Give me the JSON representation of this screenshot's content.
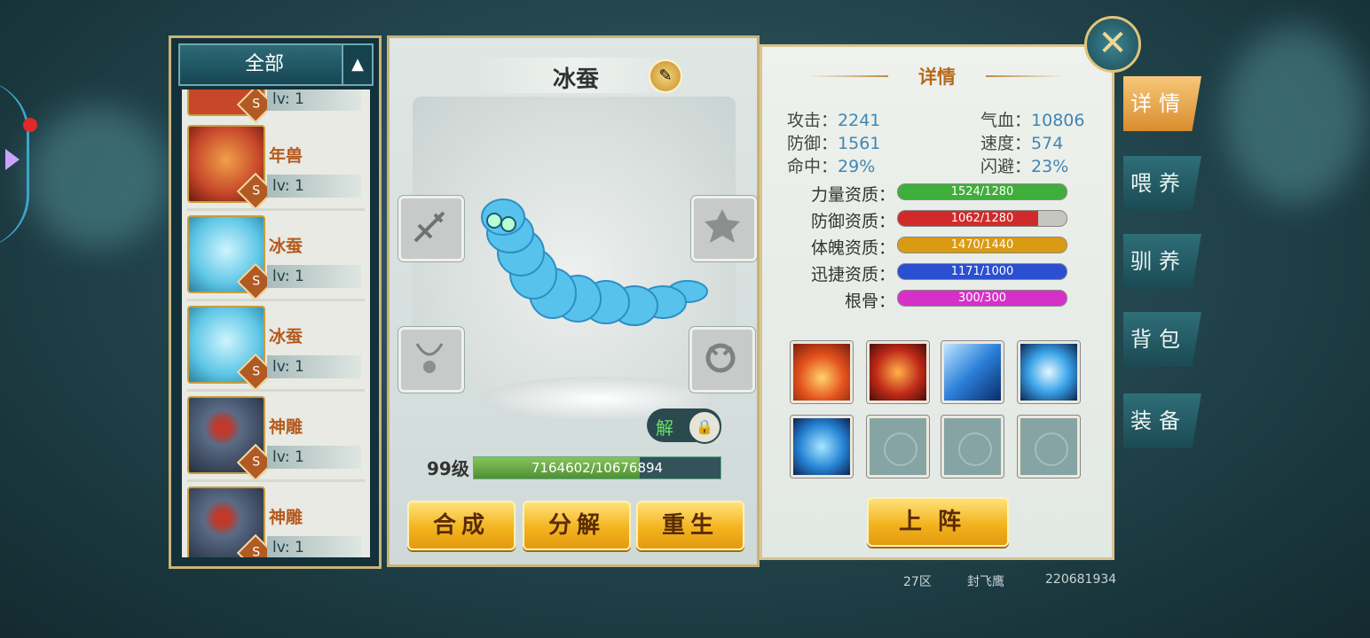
{
  "list": {
    "header": "全部",
    "toggle_icon": "chevron-up-icon",
    "partial_top_lv": "lv: 1",
    "items": [
      {
        "name": "年兽",
        "level": "lv: 1",
        "rank": "S",
        "color": "#c7472a"
      },
      {
        "name": "冰蚕",
        "level": "lv: 1",
        "rank": "S",
        "color": "#5fc7e6"
      },
      {
        "name": "冰蚕",
        "level": "lv: 1",
        "rank": "S",
        "color": "#5fc7e6"
      },
      {
        "name": "神雕",
        "level": "lv: 1",
        "rank": "S",
        "color": "#3b4a63"
      },
      {
        "name": "神雕",
        "level": "lv: 1",
        "rank": "S",
        "color": "#3b4a63"
      }
    ]
  },
  "pet": {
    "name": "冰蚕",
    "level_label": "99级",
    "exp_text": "7164602/10676894",
    "exp_fraction": 0.671,
    "unlock_label": "解"
  },
  "actions": {
    "compose": "合成",
    "decompose": "分解",
    "rebirth": "重生",
    "deploy": "上阵"
  },
  "detail": {
    "title": "详情",
    "stats": {
      "attack_label": "攻击：",
      "attack": "2241",
      "hp_label": "气血：",
      "hp": "10806",
      "defense_label": "防御：",
      "defense": "1561",
      "speed_label": "速度：",
      "speed": "574",
      "hit_label": "命中：",
      "hit": "29%",
      "dodge_label": "闪避：",
      "dodge": "23%"
    },
    "aptitudes": [
      {
        "label": "力量资质：",
        "text": "1524/1280",
        "fraction": 1.0,
        "color": "#3fae3a"
      },
      {
        "label": "防御资质：",
        "text": "1062/1280",
        "fraction": 0.83,
        "color": "#d02a2a"
      },
      {
        "label": "体魄资质：",
        "text": "1470/1440",
        "fraction": 1.0,
        "color": "#d99a14"
      },
      {
        "label": "迅捷资质：",
        "text": "1171/1000",
        "fraction": 1.0,
        "color": "#2a4fd0"
      },
      {
        "label": "根骨：",
        "text": "300/300",
        "fraction": 1.0,
        "color": "#d630c8"
      }
    ]
  },
  "tabs": [
    "详情",
    "喂养",
    "驯养",
    "背包",
    "装备"
  ],
  "footer": {
    "zone": "27区",
    "player": "封飞鹰",
    "id": "220681934"
  }
}
